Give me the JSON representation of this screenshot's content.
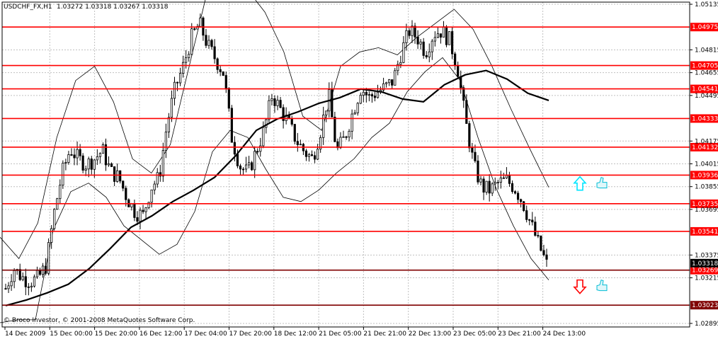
{
  "header": {
    "symbol": "USDCHF_FX,H1",
    "ohlc": "1.03272 1.03318 1.03267 1.03318"
  },
  "copyright": "© Broco Investor, © 2001-2008 MetaQuotes Software Corp.",
  "colors": {
    "background": "#ffffff",
    "grid": "#c0c0c0",
    "level_line": "#ff0000",
    "level_bg": "#ff0000",
    "candle": "#000000",
    "bollinger": "#000000",
    "moving_average": "#000000",
    "up_arrow": "#00e5ff",
    "down_arrow": "#ff0000",
    "thumb_icon": "#00bcd4"
  },
  "signals": [
    {
      "direction": "up",
      "icon": "up-arrow-icon",
      "extra_icon": "thumbs-up-icon",
      "price": 1.03875
    },
    {
      "direction": "down",
      "icon": "down-arrow-icon",
      "extra_icon": "thumbs-up-icon",
      "price": 1.03155
    }
  ],
  "chart_data": {
    "type": "candlestick",
    "symbol": "USDCHF_FX",
    "timeframe": "H1",
    "ylim": [
      1.0287,
      1.0515
    ],
    "y_ticks": [
      "1.05135",
      "1.04815",
      "1.04655",
      "1.04495",
      "1.04175",
      "1.04015",
      "1.03855",
      "1.03695",
      "1.03375",
      "1.03215",
      "1.02895"
    ],
    "x_ticks": [
      "14 Dec 2009",
      "15 Dec 00:00",
      "15 Dec 20:00",
      "16 Dec 12:00",
      "17 Dec 04:00",
      "17 Dec 20:00",
      "18 Dec 12:00",
      "21 Dec 05:00",
      "21 Dec 21:00",
      "22 Dec 13:00",
      "23 Dec 05:00",
      "23 Dec 21:00",
      "24 Dec 13:00"
    ],
    "grid": true,
    "levels": [
      "1.04975",
      "1.04705",
      "1.04541",
      "1.04333",
      "1.04132",
      "1.03936",
      "1.03735",
      "1.03541",
      "1.03269",
      "1.03023"
    ],
    "current_price": "1.03318",
    "close_path": [
      1.0314,
      1.0328,
      1.0322,
      1.0319,
      1.0321,
      1.033,
      1.0367,
      1.0395,
      1.0412,
      1.0405,
      1.0401,
      1.0405,
      1.0411,
      1.0396,
      1.0392,
      1.0378,
      1.0368,
      1.0365,
      1.0385,
      1.0392,
      1.043,
      1.0455,
      1.047,
      1.049,
      1.05,
      1.0485,
      1.0475,
      1.0465,
      1.042,
      1.04,
      1.0395,
      1.041,
      1.0425,
      1.045,
      1.044,
      1.043,
      1.0418,
      1.041,
      1.0405,
      1.0425,
      1.045,
      1.041,
      1.042,
      1.0438,
      1.0455,
      1.0448,
      1.0452,
      1.0455,
      1.046,
      1.048,
      1.0495,
      1.049,
      1.048,
      1.0493,
      1.0495,
      1.0488,
      1.0468,
      1.043,
      1.04,
      1.0385,
      1.0383,
      1.0388,
      1.039,
      1.0385,
      1.0375,
      1.036,
      1.0345,
      1.0331
    ],
    "moving_average": [
      1.0302,
      1.0306,
      1.0311,
      1.0317,
      1.0328,
      1.0342,
      1.0357,
      1.0365,
      1.0375,
      1.0383,
      1.0392,
      1.0407,
      1.0425,
      1.0433,
      1.0438,
      1.0444,
      1.0448,
      1.0454,
      1.0452,
      1.0447,
      1.0445,
      1.0457,
      1.0464,
      1.0467,
      1.0461,
      1.0451,
      1.0446
    ],
    "bollinger_upper": [
      1.035,
      1.0335,
      1.036,
      1.042,
      1.046,
      1.047,
      1.0445,
      1.0405,
      1.0395,
      1.0415,
      1.047,
      1.0525,
      1.0535,
      1.0525,
      1.0508,
      1.048,
      1.0435,
      1.0425,
      1.047,
      1.048,
      1.0483,
      1.0478,
      1.049,
      1.05,
      1.051,
      1.0496,
      1.047,
      1.044,
      1.0412,
      1.0385
    ],
    "bollinger_lower": [
      1.029,
      1.0292,
      1.0292,
      1.0355,
      1.0382,
      1.0388,
      1.0378,
      1.0358,
      1.0348,
      1.0338,
      1.0345,
      1.0368,
      1.041,
      1.0425,
      1.042,
      1.0398,
      1.0378,
      1.0375,
      1.0383,
      1.0395,
      1.0405,
      1.042,
      1.043,
      1.0452,
      1.0466,
      1.0476,
      1.046,
      1.042,
      1.0385,
      1.0358,
      1.0335,
      1.032
    ]
  }
}
